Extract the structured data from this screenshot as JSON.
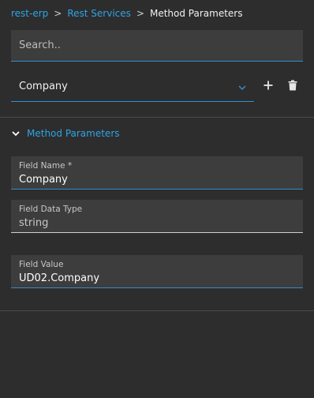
{
  "breadcrumb": {
    "items": [
      "rest-erp",
      "Rest Services"
    ],
    "current": "Method Parameters",
    "separator": ">"
  },
  "search": {
    "placeholder": "Search..",
    "value": ""
  },
  "selector": {
    "value": "Company"
  },
  "toolbar": {
    "add_icon": "plus-icon",
    "delete_icon": "trash-icon"
  },
  "section": {
    "title": "Method Parameters",
    "expanded": true
  },
  "fields": [
    {
      "label": "Field Name *",
      "value": "Company"
    },
    {
      "label": "Field Data Type",
      "value": "string"
    },
    {
      "label": "Field Value",
      "value": "UD02.Company"
    }
  ],
  "colors": {
    "background": "#2d2d2d",
    "accent": "#2fa4e7",
    "field_bg": "#3d3d3d"
  }
}
